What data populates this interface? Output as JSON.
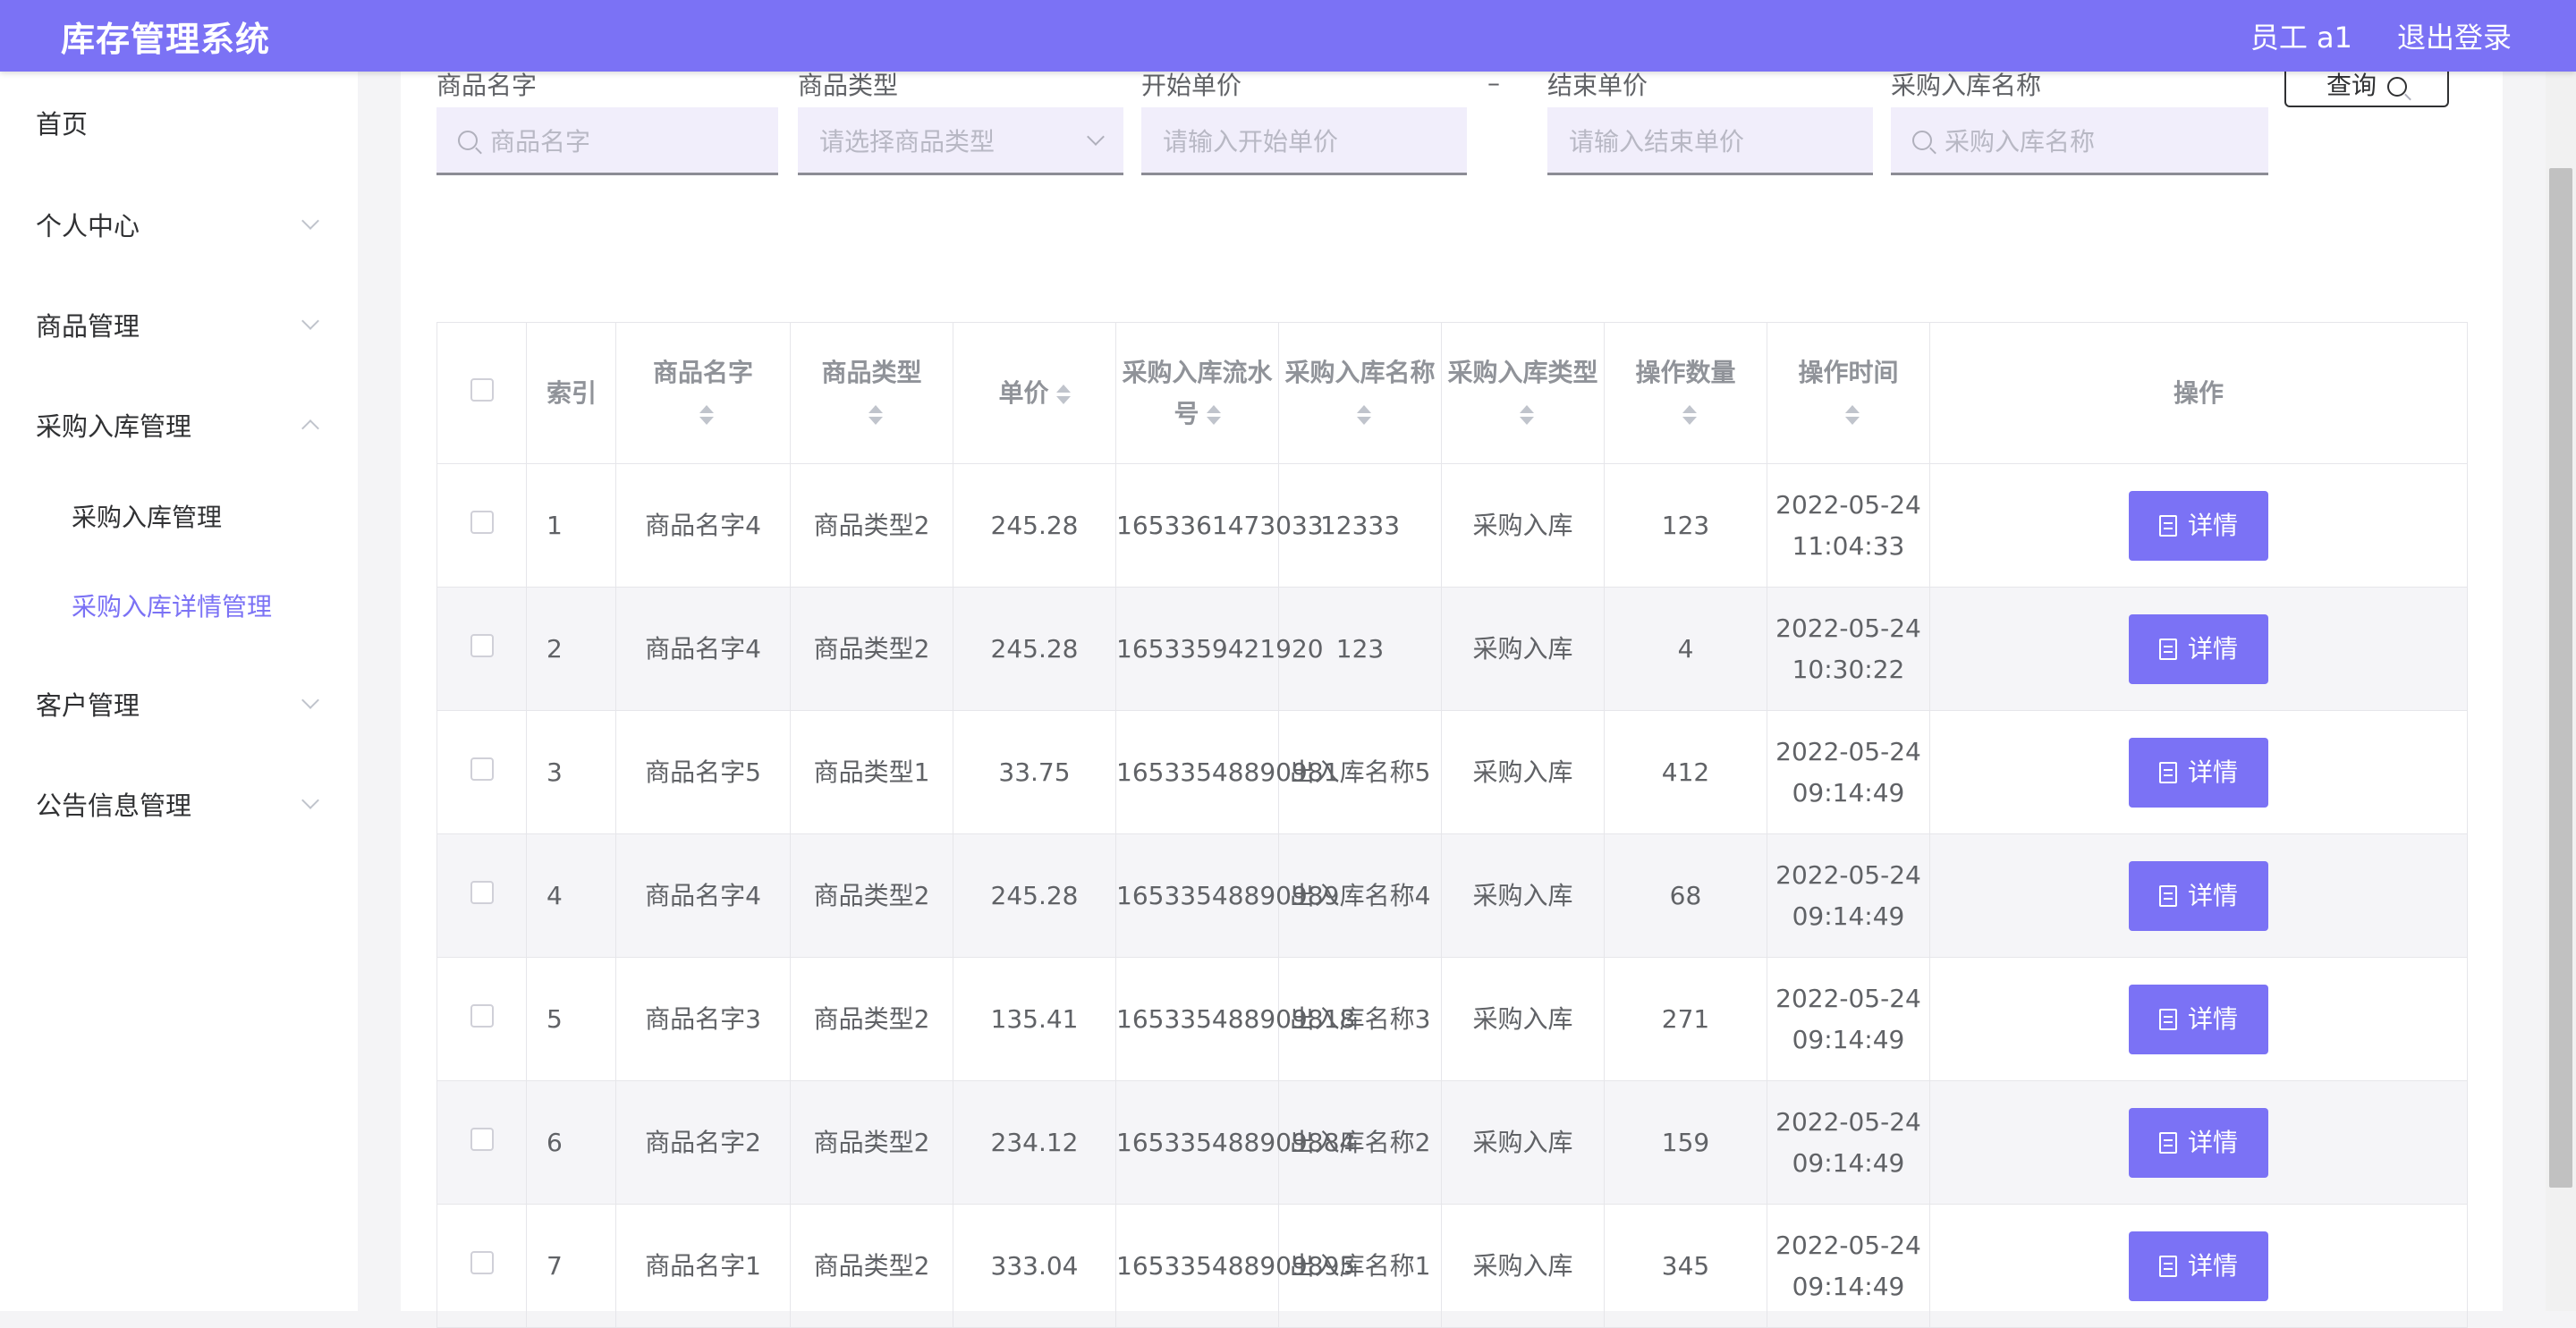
{
  "app": {
    "title": "库存管理系统"
  },
  "header": {
    "user": "员工 a1",
    "logout": "退出登录"
  },
  "sidebar": {
    "items": [
      {
        "label": "首页"
      },
      {
        "label": "个人中心"
      },
      {
        "label": "商品管理"
      },
      {
        "label": "采购入库管理"
      },
      {
        "label": "采购入库管理"
      },
      {
        "label": "采购入库详情管理"
      },
      {
        "label": "客户管理"
      },
      {
        "label": "公告信息管理"
      }
    ]
  },
  "filters": {
    "name_label": "商品名字",
    "name_placeholder": "商品名字",
    "type_label": "商品类型",
    "type_placeholder": "请选择商品类型",
    "start_price_label": "开始单价",
    "start_price_placeholder": "请输入开始单价",
    "range_sep": "–",
    "end_price_label": "结束单价",
    "end_price_placeholder": "请输入结束单价",
    "in_name_label": "采购入库名称",
    "in_name_placeholder": "采购入库名称",
    "query_label": "查询"
  },
  "table": {
    "headers": {
      "index": "索引",
      "name": "商品名字",
      "type": "商品类型",
      "price": "单价",
      "serial": "采购入库流水号",
      "in_name": "采购入库名称",
      "in_type": "采购入库类型",
      "qty": "操作数量",
      "time": "操作时间",
      "action": "操作"
    },
    "detail_label": "详情",
    "rows": [
      {
        "index": "1",
        "name": "商品名字4",
        "type": "商品类型2",
        "price": "245.28",
        "serial": "1653361473033",
        "in_name": "12333",
        "in_type": "采购入库",
        "qty": "123",
        "time": "2022-05-24 11:04:33"
      },
      {
        "index": "2",
        "name": "商品名字4",
        "type": "商品类型2",
        "price": "245.28",
        "serial": "1653359421920",
        "in_name": "123",
        "in_type": "采购入库",
        "qty": "4",
        "time": "2022-05-24 10:30:22"
      },
      {
        "index": "3",
        "name": "商品名字5",
        "type": "商品类型1",
        "price": "33.75",
        "serial": "16533548890981",
        "in_name": "出入库名称5",
        "in_type": "采购入库",
        "qty": "412",
        "time": "2022-05-24 09:14:49"
      },
      {
        "index": "4",
        "name": "商品名字4",
        "type": "商品类型2",
        "price": "245.28",
        "serial": "16533548890989",
        "in_name": "出入库名称4",
        "in_type": "采购入库",
        "qty": "68",
        "time": "2022-05-24 09:14:49"
      },
      {
        "index": "5",
        "name": "商品名字3",
        "type": "商品类型2",
        "price": "135.41",
        "serial": "165335488909818",
        "in_name": "出入库名称3",
        "in_type": "采购入库",
        "qty": "271",
        "time": "2022-05-24 09:14:49"
      },
      {
        "index": "6",
        "name": "商品名字2",
        "type": "商品类型2",
        "price": "234.12",
        "serial": "165335488909884",
        "in_name": "出入库名称2",
        "in_type": "采购入库",
        "qty": "159",
        "time": "2022-05-24 09:14:49"
      },
      {
        "index": "7",
        "name": "商品名字1",
        "type": "商品类型2",
        "price": "333.04",
        "serial": "165335488909895",
        "in_name": "出入库名称1",
        "in_type": "采购入库",
        "qty": "345",
        "time": "2022-05-24 09:14:49"
      }
    ]
  },
  "colors": {
    "accent": "#7b72f5",
    "alt_row": "#f5f5f8"
  }
}
